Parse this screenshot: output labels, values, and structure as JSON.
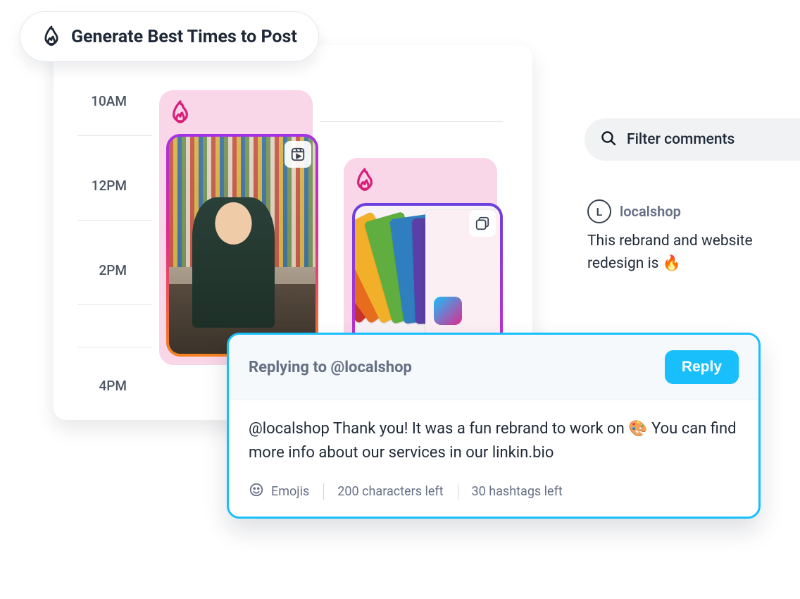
{
  "generate_pill": {
    "label": "Generate Best Times to Post"
  },
  "calendar": {
    "times": [
      "10AM",
      "12PM",
      "2PM",
      "4PM"
    ]
  },
  "filter": {
    "label": "Filter comments"
  },
  "comment": {
    "avatar_letter": "L",
    "username": "localshop",
    "text": "This rebrand and website redesign is 🔥"
  },
  "reply": {
    "heading": "Replying to @localshop",
    "button": "Reply",
    "body": "@localshop Thank you! It was a fun rebrand to work on 🎨 You can find more info about our services in our linkin.bio",
    "emojis_label": "Emojis",
    "chars_left": "200 characters left",
    "hashtags_left": "30 hashtags left"
  }
}
